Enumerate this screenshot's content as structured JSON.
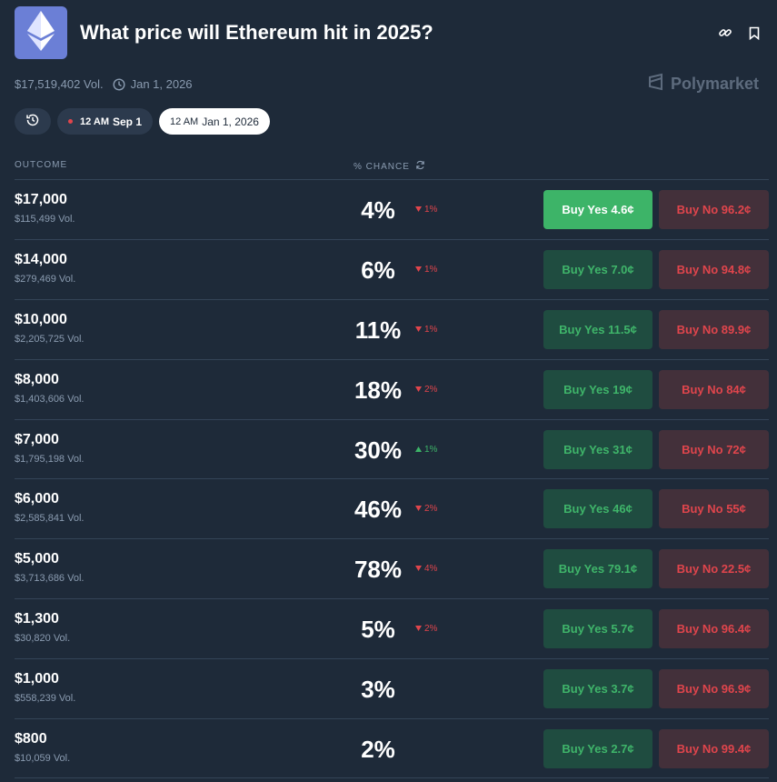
{
  "header": {
    "title": "What price will Ethereum hit in 2025?",
    "logo_icon": "ethereum-icon",
    "actions": [
      "link-icon",
      "bookmark-icon"
    ]
  },
  "meta": {
    "volume": "$17,519,402 Vol.",
    "end_date": "Jan 1, 2026",
    "brand": "Polymarket"
  },
  "filters": {
    "history_icon": "history-icon",
    "chip1": {
      "am": "12 AM",
      "date": "Sep 1"
    },
    "chip2": {
      "am": "12 AM",
      "date": "Jan 1, 2026"
    }
  },
  "table": {
    "col_outcome": "OUTCOME",
    "col_chance": "% CHANCE"
  },
  "rows": [
    {
      "name": "$17,000",
      "vol": "$115,499 Vol.",
      "pct": "4%",
      "chg": "1%",
      "dir": "down",
      "yes": "Buy Yes 4.6¢",
      "no": "Buy No 96.2¢",
      "primary": true
    },
    {
      "name": "$14,000",
      "vol": "$279,469 Vol.",
      "pct": "6%",
      "chg": "1%",
      "dir": "down",
      "yes": "Buy Yes 7.0¢",
      "no": "Buy No 94.8¢"
    },
    {
      "name": "$10,000",
      "vol": "$2,205,725 Vol.",
      "pct": "11%",
      "chg": "1%",
      "dir": "down",
      "yes": "Buy Yes 11.5¢",
      "no": "Buy No 89.9¢"
    },
    {
      "name": "$8,000",
      "vol": "$1,403,606 Vol.",
      "pct": "18%",
      "chg": "2%",
      "dir": "down",
      "yes": "Buy Yes 19¢",
      "no": "Buy No 84¢"
    },
    {
      "name": "$7,000",
      "vol": "$1,795,198 Vol.",
      "pct": "30%",
      "chg": "1%",
      "dir": "up",
      "yes": "Buy Yes 31¢",
      "no": "Buy No 72¢"
    },
    {
      "name": "$6,000",
      "vol": "$2,585,841 Vol.",
      "pct": "46%",
      "chg": "2%",
      "dir": "down",
      "yes": "Buy Yes 46¢",
      "no": "Buy No 55¢"
    },
    {
      "name": "$5,000",
      "vol": "$3,713,686 Vol.",
      "pct": "78%",
      "chg": "4%",
      "dir": "down",
      "yes": "Buy Yes 79.1¢",
      "no": "Buy No 22.5¢"
    },
    {
      "name": "$1,300",
      "vol": "$30,820 Vol.",
      "pct": "5%",
      "chg": "2%",
      "dir": "down",
      "yes": "Buy Yes 5.7¢",
      "no": "Buy No 96.4¢"
    },
    {
      "name": "$1,000",
      "vol": "$558,239 Vol.",
      "pct": "3%",
      "chg": "",
      "dir": "none",
      "yes": "Buy Yes 3.7¢",
      "no": "Buy No 96.9¢"
    },
    {
      "name": "$800",
      "vol": "$10,059 Vol.",
      "pct": "2%",
      "chg": "",
      "dir": "none",
      "yes": "Buy Yes 2.7¢",
      "no": "Buy No 99.4¢"
    }
  ],
  "colors": {
    "background": "#1e2a39",
    "yes_green": "#3db468",
    "no_red": "#e0454c"
  }
}
